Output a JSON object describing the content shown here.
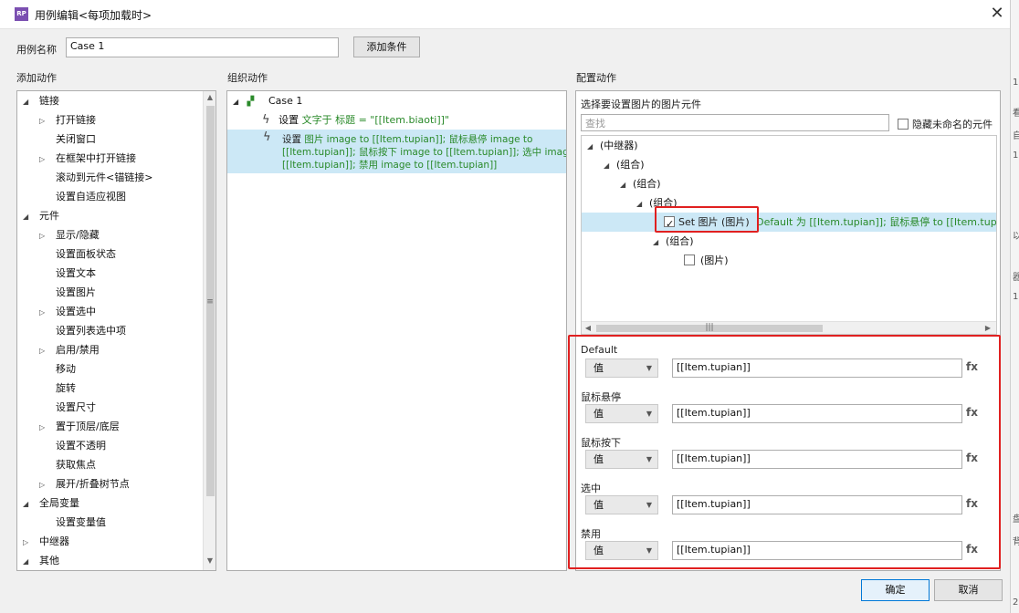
{
  "window": {
    "app_icon_text": "RP",
    "title": "用例编辑<每项加载时>",
    "close_glyph": "✕"
  },
  "name_row": {
    "label": "用例名称",
    "value": "Case 1",
    "add_condition": "添加条件"
  },
  "headers": {
    "add_actions": "添加动作",
    "organize_actions": "组织动作",
    "configure_actions": "配置动作"
  },
  "actions_tree": [
    {
      "label": "链接",
      "expanded": true,
      "level": 0
    },
    {
      "label": "打开链接",
      "expandable": true,
      "level": 1
    },
    {
      "label": "关闭窗口",
      "level": 1
    },
    {
      "label": "在框架中打开链接",
      "expandable": true,
      "level": 1
    },
    {
      "label": "滚动到元件<锚链接>",
      "level": 1
    },
    {
      "label": "设置自适应视图",
      "level": 1
    },
    {
      "label": "元件",
      "expanded": true,
      "level": 0
    },
    {
      "label": "显示/隐藏",
      "expandable": true,
      "level": 1
    },
    {
      "label": "设置面板状态",
      "level": 1
    },
    {
      "label": "设置文本",
      "level": 1
    },
    {
      "label": "设置图片",
      "level": 1
    },
    {
      "label": "设置选中",
      "expandable": true,
      "level": 1
    },
    {
      "label": "设置列表选中项",
      "level": 1
    },
    {
      "label": "启用/禁用",
      "expandable": true,
      "level": 1
    },
    {
      "label": "移动",
      "level": 1
    },
    {
      "label": "旋转",
      "level": 1
    },
    {
      "label": "设置尺寸",
      "level": 1
    },
    {
      "label": "置于顶层/底层",
      "expandable": true,
      "level": 1
    },
    {
      "label": "设置不透明",
      "level": 1
    },
    {
      "label": "获取焦点",
      "level": 1
    },
    {
      "label": "展开/折叠树节点",
      "expandable": true,
      "level": 1
    },
    {
      "label": "全局变量",
      "expanded": true,
      "level": 0
    },
    {
      "label": "设置变量值",
      "level": 1
    },
    {
      "label": "中继器",
      "expandable": true,
      "level": 0
    },
    {
      "label": "其他",
      "expanded": true,
      "level": 0
    }
  ],
  "organize": {
    "case_label": "Case 1",
    "action1": {
      "prefix": "设置 ",
      "detail": "文字于 标题 = \"[[Item.biaoti]]\""
    },
    "action2": {
      "line1_prefix": "设置 ",
      "line1_detail": "图片 image to [[Item.tupian]]; 鼠标悬停 image to",
      "line2": "[[Item.tupian]]; 鼠标按下 image to [[Item.tupian]]; 选中 image to",
      "line3": "[[Item.tupian]]; 禁用 image to [[Item.tupian]]"
    }
  },
  "configure": {
    "select_prompt": "选择要设置图片的图片元件",
    "search_placeholder": "查找",
    "hide_unnamed": "隐藏未命名的元件",
    "tree": {
      "repeater": "(中继器)",
      "group1": "(组合)",
      "group2": "(组合)",
      "group3": "(组合)",
      "set_image": "Set 图片 (图片)",
      "set_image_detail": "Default 为 [[Item.tupian]]; 鼠标悬停 to [[Item.tupian]]; 鼠标",
      "group4": "(组合)",
      "image": "(图片)"
    },
    "states": [
      {
        "label": "Default",
        "type": "值",
        "value": "[[Item.tupian]]",
        "fx": "fx"
      },
      {
        "label": "鼠标悬停",
        "type": "值",
        "value": "[[Item.tupian]]",
        "fx": "fx"
      },
      {
        "label": "鼠标按下",
        "type": "值",
        "value": "[[Item.tupian]]",
        "fx": "fx"
      },
      {
        "label": "选中",
        "type": "值",
        "value": "[[Item.tupian]]",
        "fx": "fx"
      },
      {
        "label": "禁用",
        "type": "值",
        "value": "[[Item.tupian]]",
        "fx": "fx"
      }
    ]
  },
  "footer": {
    "ok": "确定",
    "cancel": "取消"
  },
  "right_strip_chars": [
    "1",
    "看",
    "自",
    "1",
    "以",
    "器",
    "1",
    "盘",
    "背",
    "2"
  ],
  "colors": {
    "highlight": "#cce8f6",
    "accent_red": "#e02020",
    "green_text": "#2a8a2a"
  }
}
